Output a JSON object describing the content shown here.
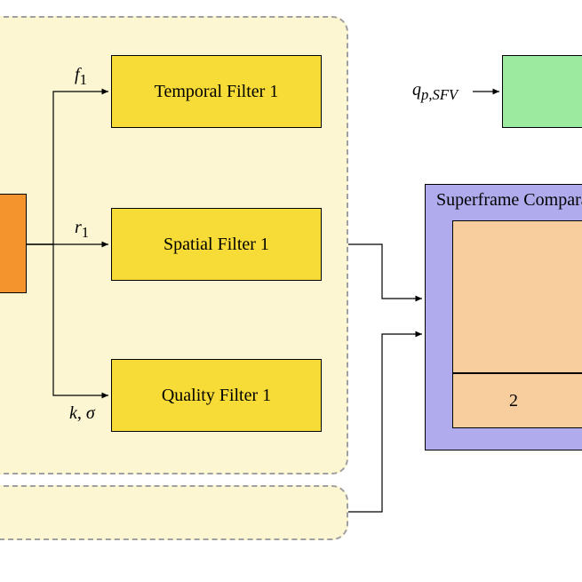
{
  "filters": {
    "temporal": "Temporal Filter 1",
    "spatial": "Spatial Filter 1",
    "quality": "Quality Filter 1"
  },
  "edge_labels": {
    "f1": "f",
    "f1_sub": "1",
    "r1": "r",
    "r1_sub": "1",
    "ksigma_k": "k",
    "ksigma_sep": ", ",
    "ksigma_sigma": "σ",
    "q": "q",
    "q_sub1": "p",
    "q_sep": ",",
    "q_sub2": "SFV"
  },
  "superframe": {
    "title_full": "Superframe Comparator",
    "cell_value": "2"
  }
}
